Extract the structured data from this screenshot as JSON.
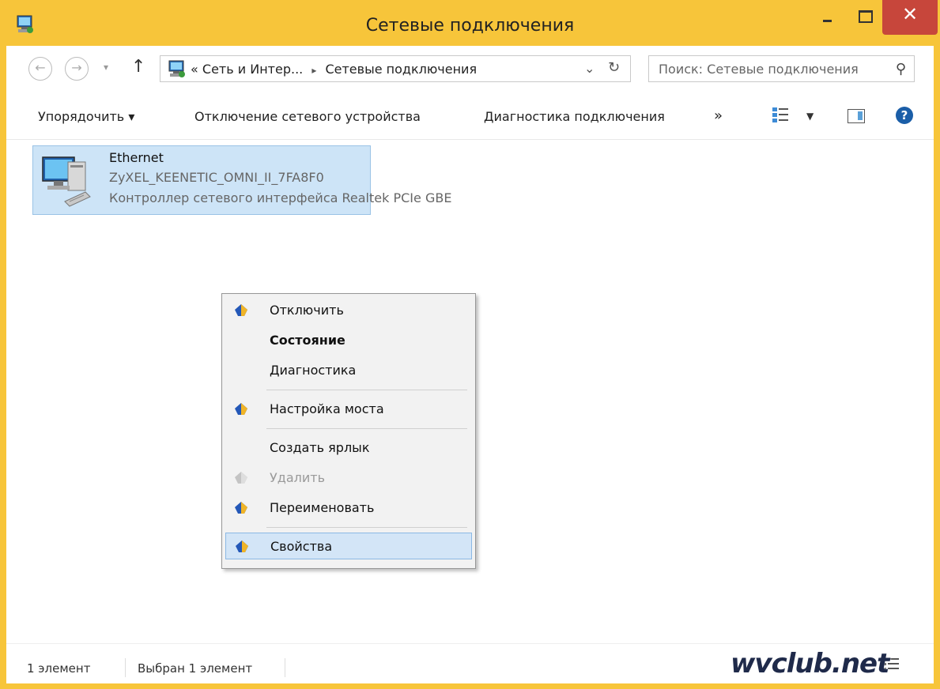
{
  "window": {
    "title": "Сетевые подключения",
    "minimize_icon": "minimize-icon",
    "maximize_icon": "maximize-icon",
    "close_glyph": "✕"
  },
  "address_bar": {
    "prefix": "«",
    "path": [
      "Сеть и Интер...",
      "Сетевые подключения"
    ],
    "separator": "▸",
    "search_placeholder": "Поиск: Сетевые подключения"
  },
  "toolbar": {
    "organize": "Упорядочить ▾",
    "disable_device": "Отключение сетевого устройства",
    "diagnose": "Диагностика подключения",
    "more": "»"
  },
  "connection": {
    "name": "Ethernet",
    "network": "ZyXEL_KEENETIC_OMNI_II_7FA8F0",
    "device": "Контроллер сетевого интерфейса Realtek PCIe GBE"
  },
  "context_menu": {
    "items": [
      {
        "label": "Отключить",
        "icon": "shield-icon"
      },
      {
        "label": "Состояние",
        "bold": true
      },
      {
        "label": "Диагностика"
      },
      {
        "label": "Настройка моста",
        "icon": "shield-icon"
      },
      {
        "label": "Создать ярлык"
      },
      {
        "label": "Удалить",
        "icon": "shield-icon",
        "disabled": true
      },
      {
        "label": "Переименовать",
        "icon": "shield-icon"
      },
      {
        "label": "Свойства",
        "icon": "shield-icon",
        "highlighted": true
      }
    ]
  },
  "status_bar": {
    "count": "1 элемент",
    "selected": "Выбран 1 элемент"
  },
  "watermark": "wvclub.net",
  "colors": {
    "title_bar": "#f7c53a",
    "close_button": "#c7463b",
    "selection": "#cde4f7",
    "menu_highlight": "#d3e5f7"
  }
}
